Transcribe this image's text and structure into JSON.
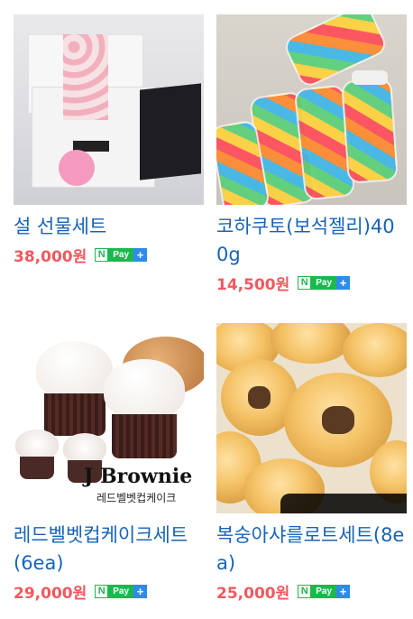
{
  "products": [
    {
      "name": "설 선물세트",
      "price": "38,000원",
      "pay": {
        "n": "N",
        "label": "Pay",
        "plus": "+"
      }
    },
    {
      "name": "코하쿠토(보석젤리)400g",
      "price": "14,500원",
      "pay": {
        "n": "N",
        "label": "Pay",
        "plus": "+"
      }
    },
    {
      "name": "레드벨벳컵케이크세트(6ea)",
      "price": "29,000원",
      "pay": {
        "n": "N",
        "label": "Pay",
        "plus": "+"
      },
      "image_text": {
        "brand": "J Brownie",
        "sub": "레드벨벳컵케이크"
      }
    },
    {
      "name": "복숭아샤를로트세트(8ea)",
      "price": "25,000원",
      "pay": {
        "n": "N",
        "label": "Pay",
        "plus": "+"
      }
    }
  ],
  "colors": {
    "name": "#1763b9",
    "price": "#f1585d",
    "npay_green": "#19b94e",
    "npay_blue": "#2e8ce6"
  }
}
